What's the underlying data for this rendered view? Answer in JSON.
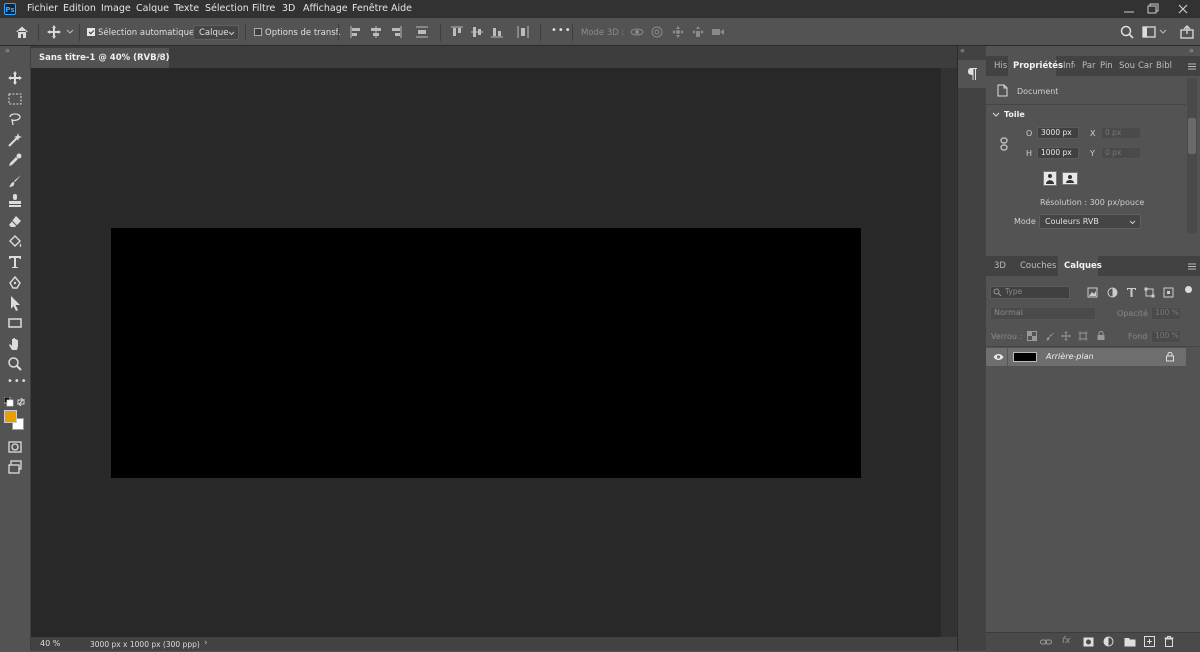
{
  "app": {
    "logo": "Ps"
  },
  "menu": [
    "Fichier",
    "Edition",
    "Image",
    "Calque",
    "Texte",
    "Sélection",
    "Filtre",
    "3D",
    "Affichage",
    "Fenêtre",
    "Aide"
  ],
  "options_bar": {
    "auto_select_label": "Sélection automatique :",
    "auto_select_checked": true,
    "auto_select_target": "Calque",
    "transform_label": "Options de transf.",
    "transform_checked": false,
    "more": "•••",
    "mode_3d_label": "Mode 3D :"
  },
  "document": {
    "tab_title": "Sans titre-1 @ 40% (RVB/8)",
    "canvas_color": "#000000",
    "zoom": "40 %",
    "info": "3000 px x 1000 px (300 ppp)"
  },
  "swatches": {
    "foreground": "#e8a000",
    "background": "#ffffff"
  },
  "properties_panel": {
    "tabs": [
      "His",
      "Propriétés",
      "Info",
      "Par",
      "Pin",
      "Sou",
      "Car",
      "Bibl"
    ],
    "active_tab": "Propriétés",
    "doc_label": "Document",
    "section": "Toile",
    "width_label": "O",
    "width_value": "3000 px",
    "height_label": "H",
    "height_value": "1000 px",
    "x_label": "X",
    "x_value": "0 px",
    "y_label": "Y",
    "y_value": "0 px",
    "resolution": "Résolution : 300 px/pouce",
    "mode_label": "Mode",
    "mode_value": "Couleurs RVB"
  },
  "layers_panel": {
    "tabs": [
      "3D",
      "Couches",
      "Calques"
    ],
    "active_tab": "Calques",
    "filter_placeholder": "Type",
    "blend_mode": "Normal",
    "opacity_label": "Opacité :",
    "opacity_value": "100 %",
    "lock_label": "Verrou :",
    "fill_label": "Fond :",
    "fill_value": "100 %",
    "layers": [
      {
        "name": "Arrière-plan",
        "visible": true,
        "locked": true
      }
    ]
  }
}
